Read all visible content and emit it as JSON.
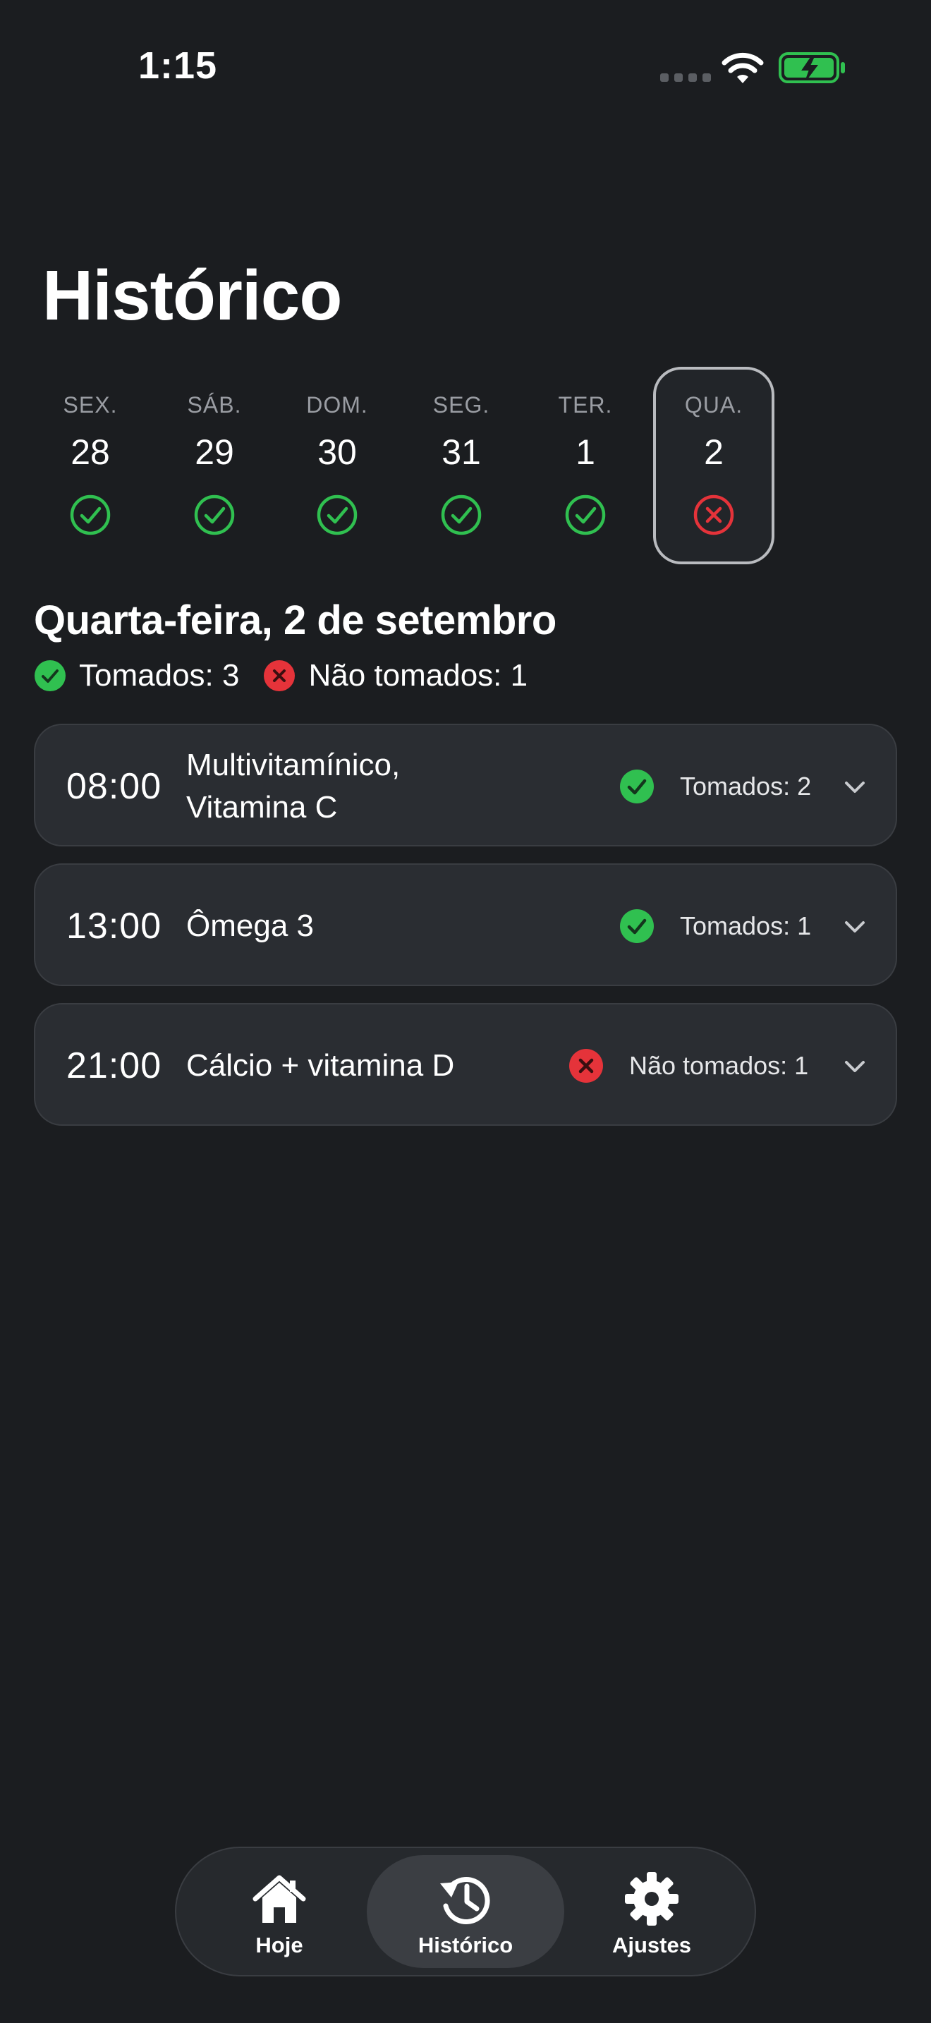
{
  "status_bar": {
    "time": "1:15",
    "battery_color": "#30c050"
  },
  "title": "Histórico",
  "week": [
    {
      "name": "SEX.",
      "num": "28",
      "status": "taken"
    },
    {
      "name": "SÁB.",
      "num": "29",
      "status": "taken"
    },
    {
      "name": "DOM.",
      "num": "30",
      "status": "taken"
    },
    {
      "name": "SEG.",
      "num": "31",
      "status": "taken"
    },
    {
      "name": "TER.",
      "num": "1",
      "status": "taken"
    },
    {
      "name": "QUA.",
      "num": "2",
      "status": "missed",
      "selected": true
    }
  ],
  "selected_date": "Quarta-feira, 2 de setembro",
  "summary": {
    "taken": "Tomados: 3",
    "missed": "Não tomados: 1"
  },
  "doses": [
    {
      "time": "08:00",
      "meds": "Multivitamínico, Vitamina C",
      "status": "taken",
      "label": "Tomados: 2"
    },
    {
      "time": "13:00",
      "meds": "Ômega 3",
      "status": "taken",
      "label": "Tomados: 1"
    },
    {
      "time": "21:00",
      "meds": "Cálcio + vitamina D",
      "status": "missed",
      "label": "Não tomados: 1"
    }
  ],
  "tabs": [
    {
      "label": "Hoje",
      "icon": "home-icon"
    },
    {
      "label": "Histórico",
      "icon": "history-icon",
      "active": true
    },
    {
      "label": "Ajustes",
      "icon": "gear-icon"
    }
  ],
  "colors": {
    "taken": "#30c050",
    "missed": "#e5333a",
    "background": "#1b1d20",
    "card": "#2a2d32"
  }
}
